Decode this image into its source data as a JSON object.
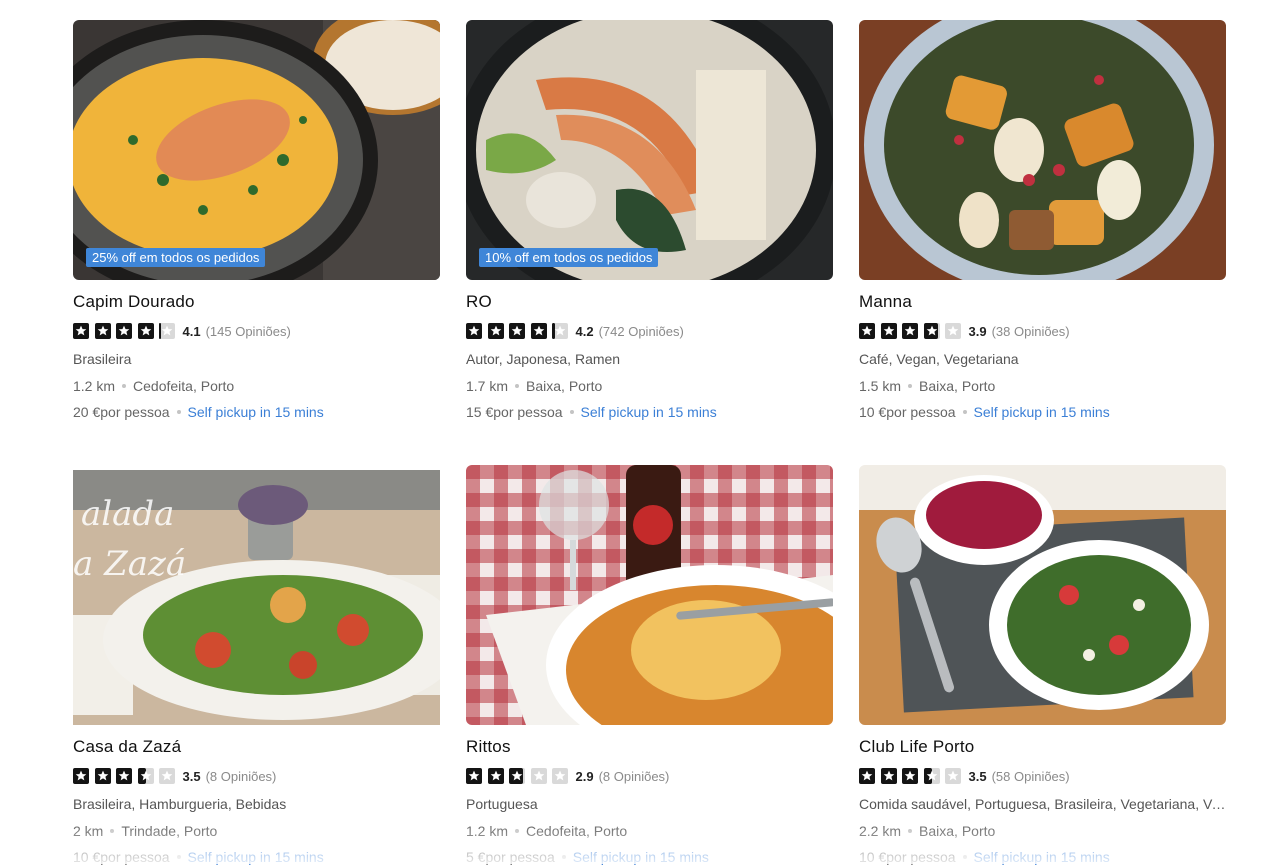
{
  "restaurants": [
    {
      "name": "Capim Dourado",
      "promo": "25% off em todos os pedidos",
      "rating": 4.1,
      "rating_text": "4.1",
      "reviews": "(145 Opiniões)",
      "cuisine": "Brasileira",
      "distance": "1.2 km",
      "location": "Cedofeita, Porto",
      "price": "20 €por pessoa",
      "pickup": "Self pickup in 15 mins",
      "photo": "soup-photo"
    },
    {
      "name": "RO",
      "promo": "10% off em todos os pedidos",
      "rating": 4.2,
      "rating_text": "4.2",
      "reviews": "(742 Opiniões)",
      "cuisine": "Autor, Japonesa, Ramen",
      "distance": "1.7 km",
      "location": "Baixa, Porto",
      "price": "15 €por pessoa",
      "pickup": "Self pickup in 15 mins",
      "photo": "ramen-photo"
    },
    {
      "name": "Manna",
      "promo": "",
      "rating": 3.9,
      "rating_text": "3.9",
      "reviews": "(38 Opiniões)",
      "cuisine": "Café, Vegan, Vegetariana",
      "distance": "1.5 km",
      "location": "Baixa, Porto",
      "price": "10 €por pessoa",
      "pickup": "Self pickup in 15 mins",
      "photo": "salad-bowl-photo"
    },
    {
      "name": "Casa da Zazá",
      "promo": "",
      "rating": 3.5,
      "rating_text": "3.5",
      "reviews": "(8 Opiniões)",
      "cuisine": "Brasileira, Hamburgueria, Bebidas",
      "distance": "2 km",
      "location": "Trindade, Porto",
      "price": "10 €por pessoa",
      "pickup": "Self pickup in 15 mins",
      "photo": "salad-plate-photo"
    },
    {
      "name": "Rittos",
      "promo": "",
      "rating": 2.9,
      "rating_text": "2.9",
      "reviews": "(8 Opiniões)",
      "cuisine": "Portuguesa",
      "distance": "1.2 km",
      "location": "Cedofeita, Porto",
      "price": "5 €por pessoa",
      "pickup": "Self pickup in 15 mins",
      "photo": "francesinha-photo"
    },
    {
      "name": "Club Life Porto",
      "promo": "",
      "rating": 3.5,
      "rating_text": "3.5",
      "reviews": "(58 Opiniões)",
      "cuisine": "Comida saudável, Portuguesa, Brasileira, Vegetariana, Vegan",
      "distance": "2.2 km",
      "location": "Baixa, Porto",
      "price": "10 €por pessoa",
      "pickup": "Self pickup in 15 mins",
      "photo": "soup-salad-tray-photo"
    }
  ],
  "colors": {
    "promo_bg": "#3f86d8",
    "pickup_text": "#3b7fd6",
    "star_filled": "#141414",
    "star_empty": "#d9d9d9"
  }
}
